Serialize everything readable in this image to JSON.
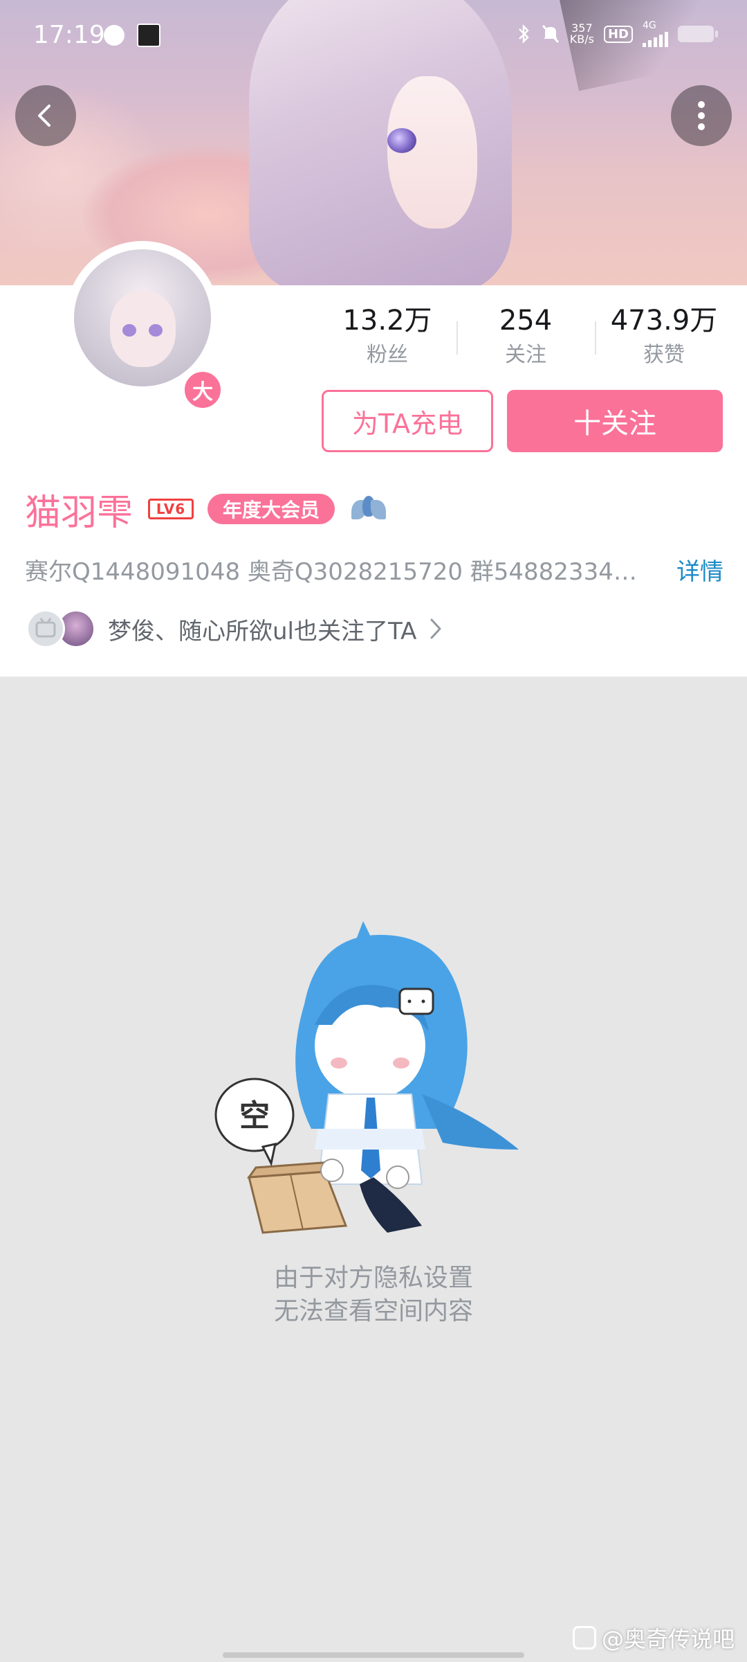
{
  "status_bar": {
    "time": "17:19",
    "speed_value": "357",
    "speed_unit": "KB/s",
    "hd_label": "HD",
    "network_label": "4G"
  },
  "header": {
    "back_icon": "chevron-left-icon",
    "more_icon": "more-vertical-icon"
  },
  "profile": {
    "vip_badge_char": "大",
    "stats": [
      {
        "value": "13.2万",
        "label": "粉丝"
      },
      {
        "value": "254",
        "label": "关注"
      },
      {
        "value": "473.9万",
        "label": "获赞"
      }
    ],
    "charge_label": "为TA充电",
    "follow_label": "十关注",
    "name": "猫羽雫",
    "level": "LV6",
    "vip_tag": "年度大会员",
    "signature": "赛尔Q1448091048 奥奇Q3028215720 群54882334…",
    "detail_label": "详情",
    "mutual_text": "梦俊、随心所欲ul也关注了TA"
  },
  "empty_state": {
    "bubble_char": "空",
    "line1": "由于对方隐私设置",
    "line2": "无法查看空间内容"
  },
  "watermark": "@奥奇传说吧",
  "colors": {
    "accent_pink": "#fb7299",
    "link_blue": "#1d8ac7",
    "muted_gray": "#9499a0",
    "background_gray": "#e6e6e6"
  }
}
